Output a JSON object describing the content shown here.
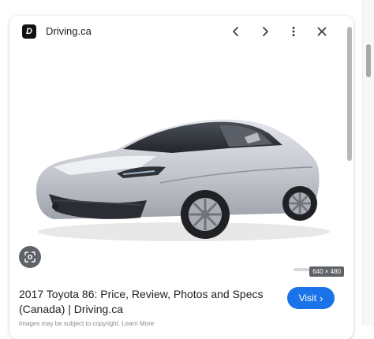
{
  "panel": {
    "site_name": "Driving.ca",
    "site_logo_letter": "D",
    "title": "2017 Toyota 86: Price, Review, Photos and Specs (Canada) | Driving.ca",
    "visit_label": "Visit",
    "visit_chevron": "›",
    "image_dimensions": "640 × 480",
    "copyright": "Images may be subject to copyright. Learn More"
  },
  "colors": {
    "accent": "#1a73e8",
    "car_body": "#c9ccd3",
    "badge": "#5f6368"
  },
  "icons": {
    "prev": "chevron-left-icon",
    "next": "chevron-right-icon",
    "more": "more-vert-icon",
    "close": "close-icon",
    "lens": "google-lens-icon"
  }
}
